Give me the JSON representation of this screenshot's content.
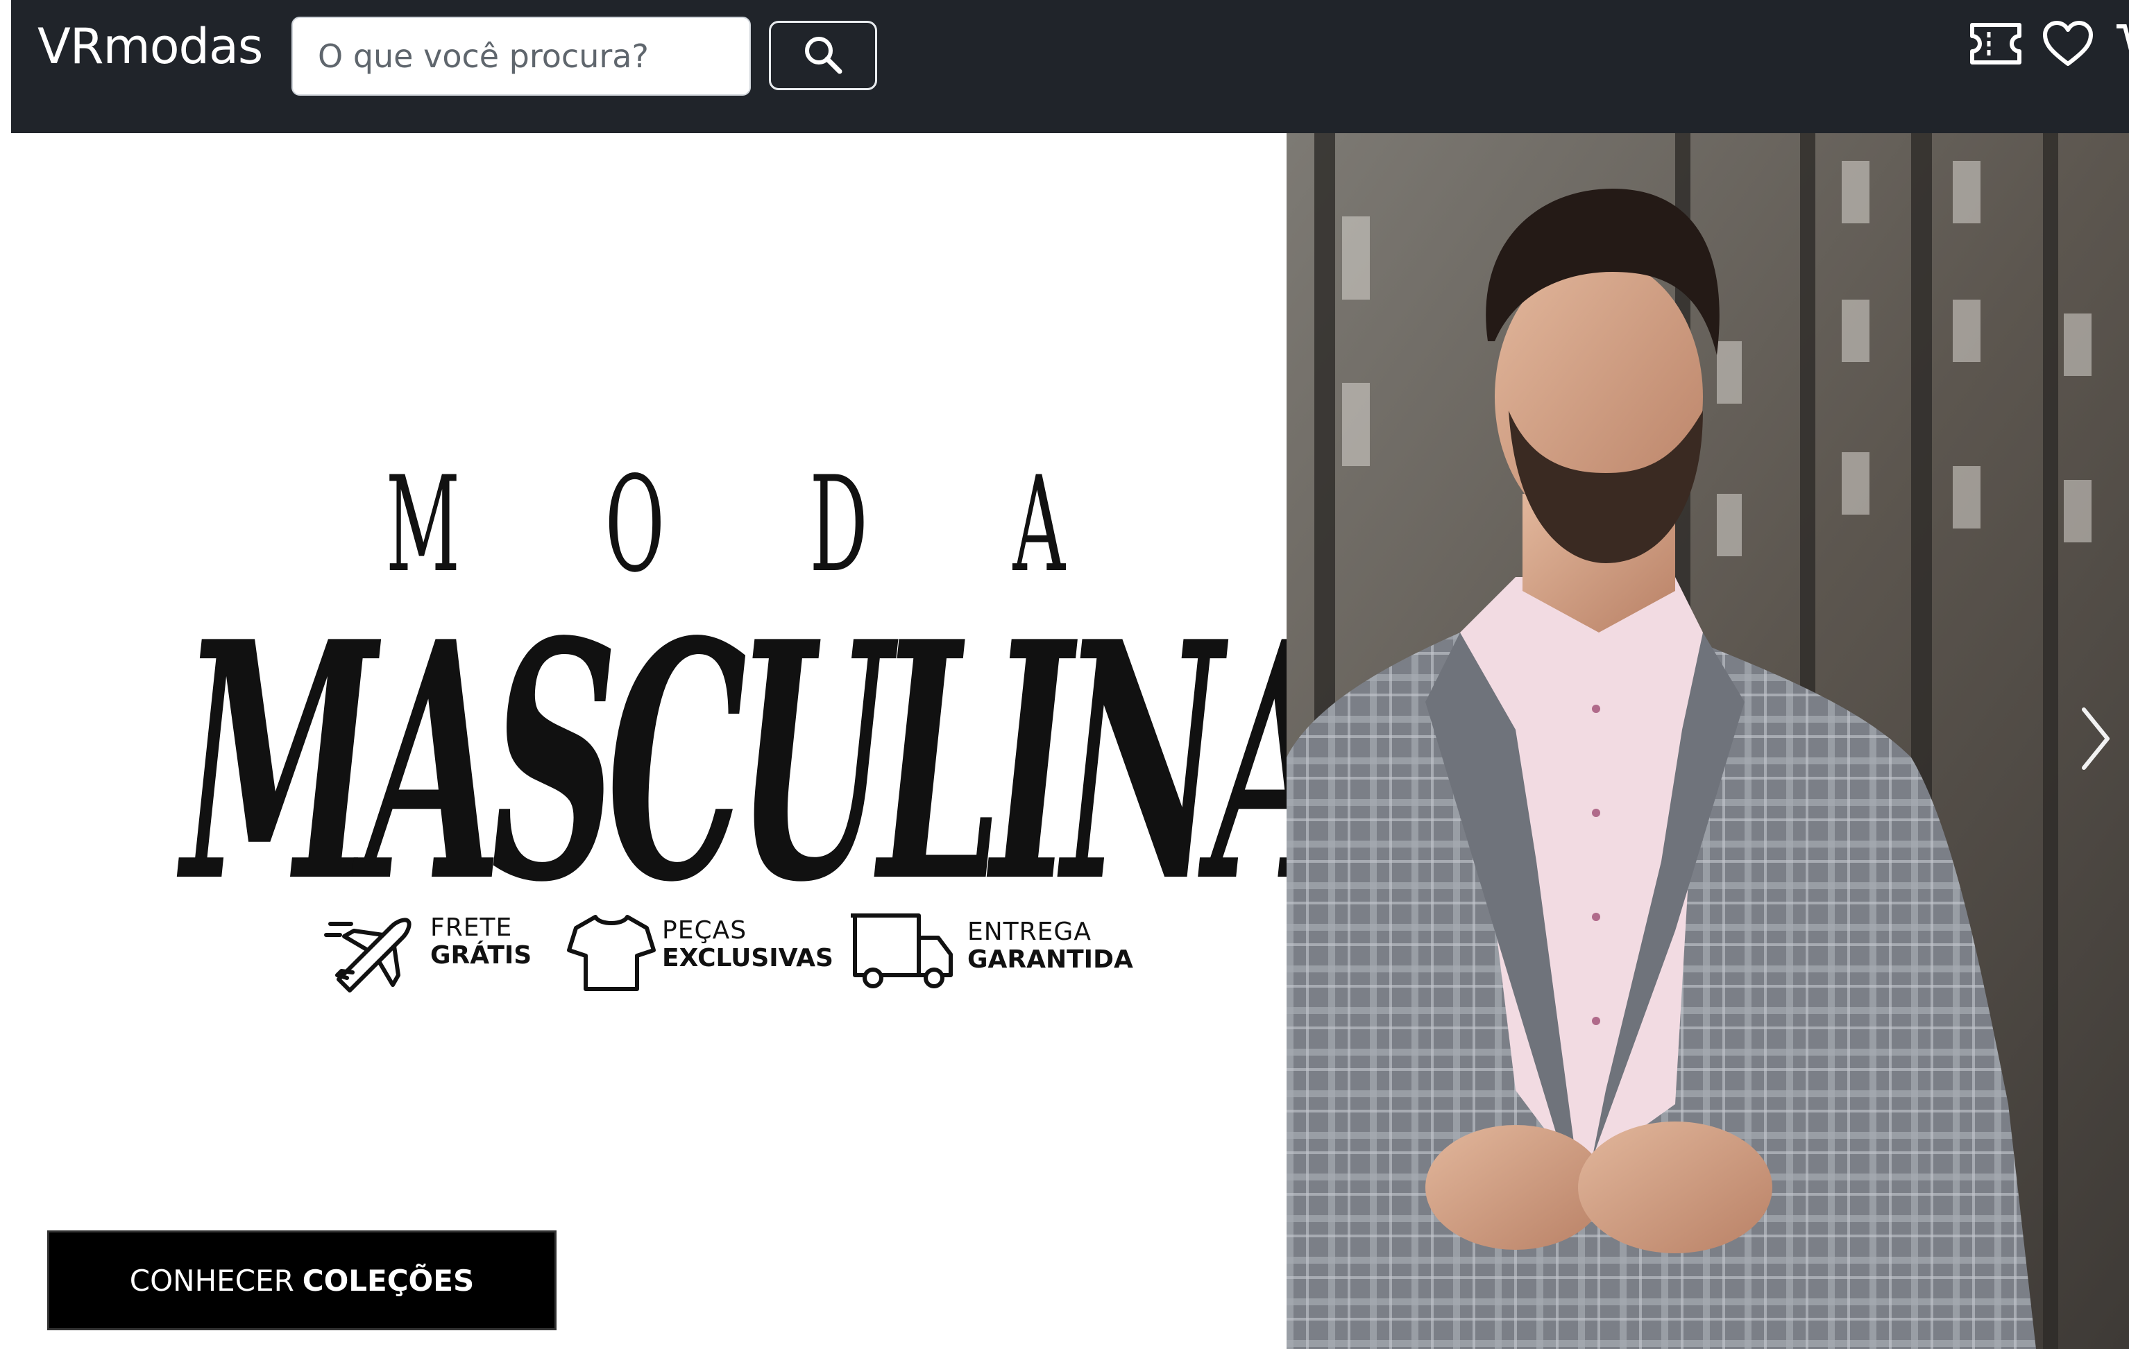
{
  "navbar": {
    "brand": "VRmodas",
    "search": {
      "placeholder": "O que você procura?",
      "value": "",
      "button_icon": "search-icon"
    },
    "icons": [
      "ticket-icon",
      "heart-icon",
      "cart-icon"
    ]
  },
  "hero": {
    "headline_top": [
      "M",
      "O",
      "D",
      "A"
    ],
    "headline_main": "MASCULINA",
    "features": [
      {
        "icon": "airplane-icon",
        "line1": "FRETE",
        "line2": "GRÁTIS"
      },
      {
        "icon": "tshirt-icon",
        "line1": "PEÇAS",
        "line2": "EXCLUSIVAS"
      },
      {
        "icon": "truck-icon",
        "line1": "ENTREGA",
        "line2": "GARANTIDA"
      }
    ],
    "cta": {
      "light": "CONHECER",
      "bold": "COLEÇÕES"
    },
    "image": "man-in-plaid-blazer-photo",
    "next_icon": "chevron-right-icon"
  },
  "colors": {
    "navbar_bg": "#20242a",
    "cta_bg": "#000000",
    "text_dark": "#111111"
  }
}
